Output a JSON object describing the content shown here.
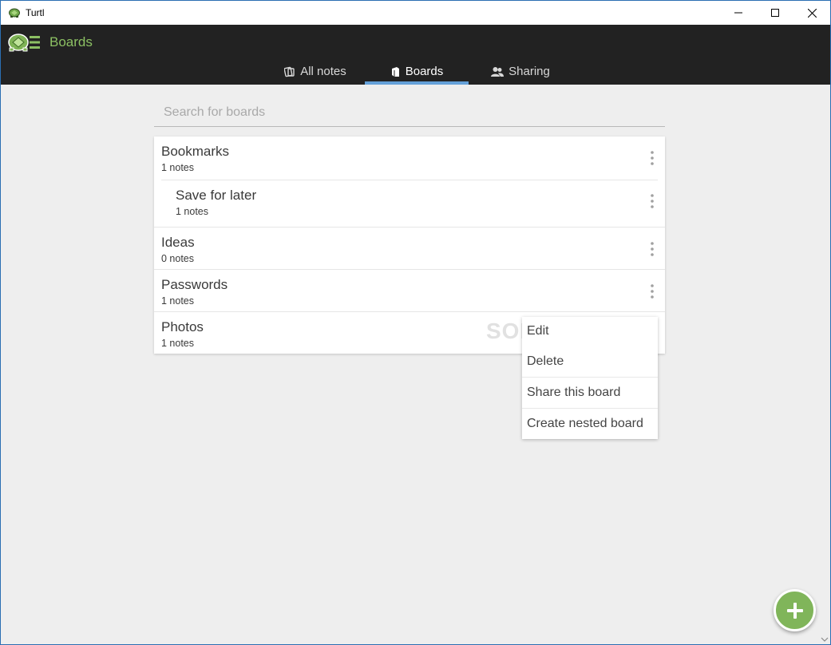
{
  "window": {
    "title": "Turtl"
  },
  "header": {
    "title": "Boards"
  },
  "tabs": [
    {
      "label": "All notes",
      "icon": "notes-icon",
      "active": false
    },
    {
      "label": "Boards",
      "icon": "board-icon",
      "active": true
    },
    {
      "label": "Sharing",
      "icon": "users-icon",
      "active": false
    }
  ],
  "search": {
    "placeholder": "Search for boards",
    "value": ""
  },
  "boards": [
    {
      "title": "Bookmarks",
      "count": "1 notes",
      "nested": false
    },
    {
      "title": "Save for later",
      "count": "1 notes",
      "nested": true
    },
    {
      "title": "Ideas",
      "count": "0 notes",
      "nested": false
    },
    {
      "title": "Passwords",
      "count": "1 notes",
      "nested": false
    },
    {
      "title": "Photos",
      "count": "1 notes",
      "nested": false
    }
  ],
  "context_menu": {
    "items": [
      "Edit",
      "Delete",
      "Share this board",
      "Create nested board"
    ]
  },
  "watermark": "SOFTPEDIA",
  "colors": {
    "header_bg": "#222222",
    "accent_green": "#8cc063",
    "tab_underline": "#64a0d8",
    "fab_bg": "#80b55a",
    "content_bg": "#eeeeee"
  }
}
